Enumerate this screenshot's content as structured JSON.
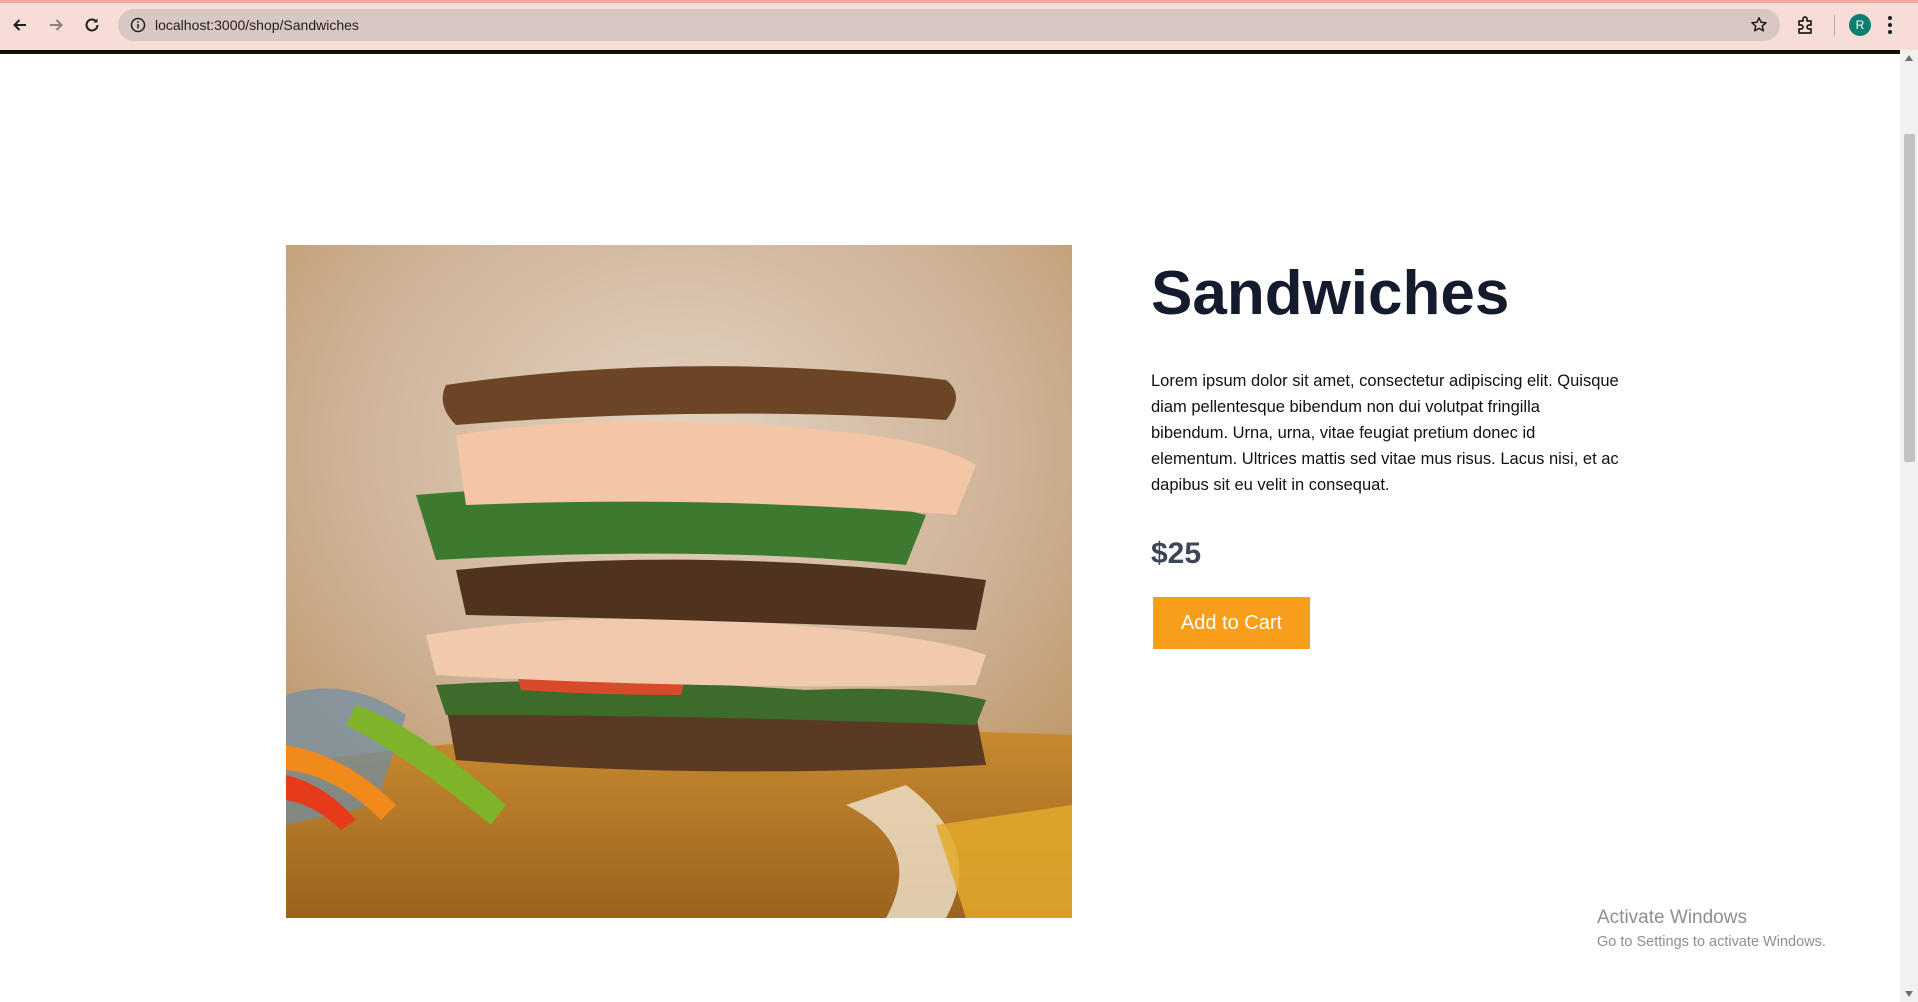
{
  "browser": {
    "url": "localhost:3000/shop/Sandwiches",
    "profile_initial": "R",
    "icons": {
      "back": "arrow-left-icon",
      "forward": "arrow-right-icon",
      "reload": "reload-icon",
      "site_info": "info-icon",
      "bookmark": "star-icon",
      "extensions": "puzzle-icon",
      "menu": "kebab-menu-icon"
    }
  },
  "product": {
    "title": "Sandwiches",
    "description": "Lorem ipsum dolor sit amet, consectetur adipiscing elit. Quisque diam pellentesque bibendum non dui volutpat fringilla bibendum. Urna, urna, vitae feugiat pretium donec id elementum. Ultrices mattis sed vitae mus risus. Lacus nisi, et ac dapibus sit eu velit in consequat.",
    "price": "$25",
    "add_to_cart_label": "Add to Cart",
    "image_alt": "Sandwiches",
    "accent_color": "#f99e1a"
  },
  "watermark": {
    "title": "Activate Windows",
    "subtitle": "Go to Settings to activate Windows."
  }
}
